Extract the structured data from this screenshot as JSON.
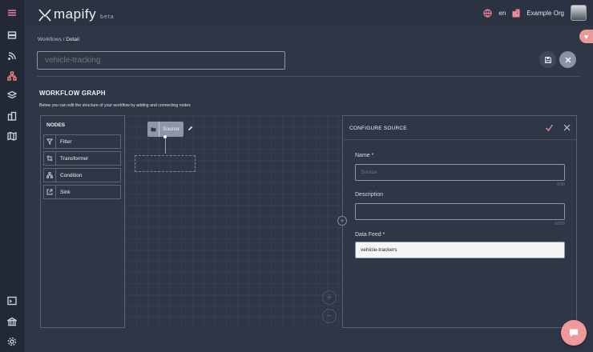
{
  "app": {
    "name": "mapify",
    "badge": "beta"
  },
  "topbar": {
    "language": "en",
    "org": "Example Org"
  },
  "breadcrumb": {
    "parent": "Workflows",
    "separator": "/",
    "current": "Detail"
  },
  "workflow": {
    "name_placeholder": "vehicle-tracking"
  },
  "graph": {
    "title": "WORKFLOW GRAPH",
    "description": "Below you can edit the structure of your workflow by adding and connecting nodes"
  },
  "nodes_panel": {
    "title": "NODES",
    "items": [
      {
        "label": "Filter",
        "icon": "filter-icon"
      },
      {
        "label": "Transformer",
        "icon": "transform-icon"
      },
      {
        "label": "Condition",
        "icon": "condition-icon"
      },
      {
        "label": "Sink",
        "icon": "sink-icon"
      }
    ]
  },
  "canvas": {
    "source_node_label": "Source",
    "zoom_in": "+",
    "zoom_out": "−",
    "expand": "+"
  },
  "config": {
    "title": "CONFIGURE SOURCE",
    "name": {
      "label": "Name *",
      "placeholder": "Source",
      "counter": "6/30"
    },
    "description": {
      "label": "Description",
      "placeholder": "",
      "counter": "0/255"
    },
    "data_feed": {
      "label": "Data Feed *",
      "value": "vehicle-trackers"
    }
  },
  "colors": {
    "accent": "#f08a9a",
    "background": "#2f3646",
    "sidebar": "#232836"
  }
}
